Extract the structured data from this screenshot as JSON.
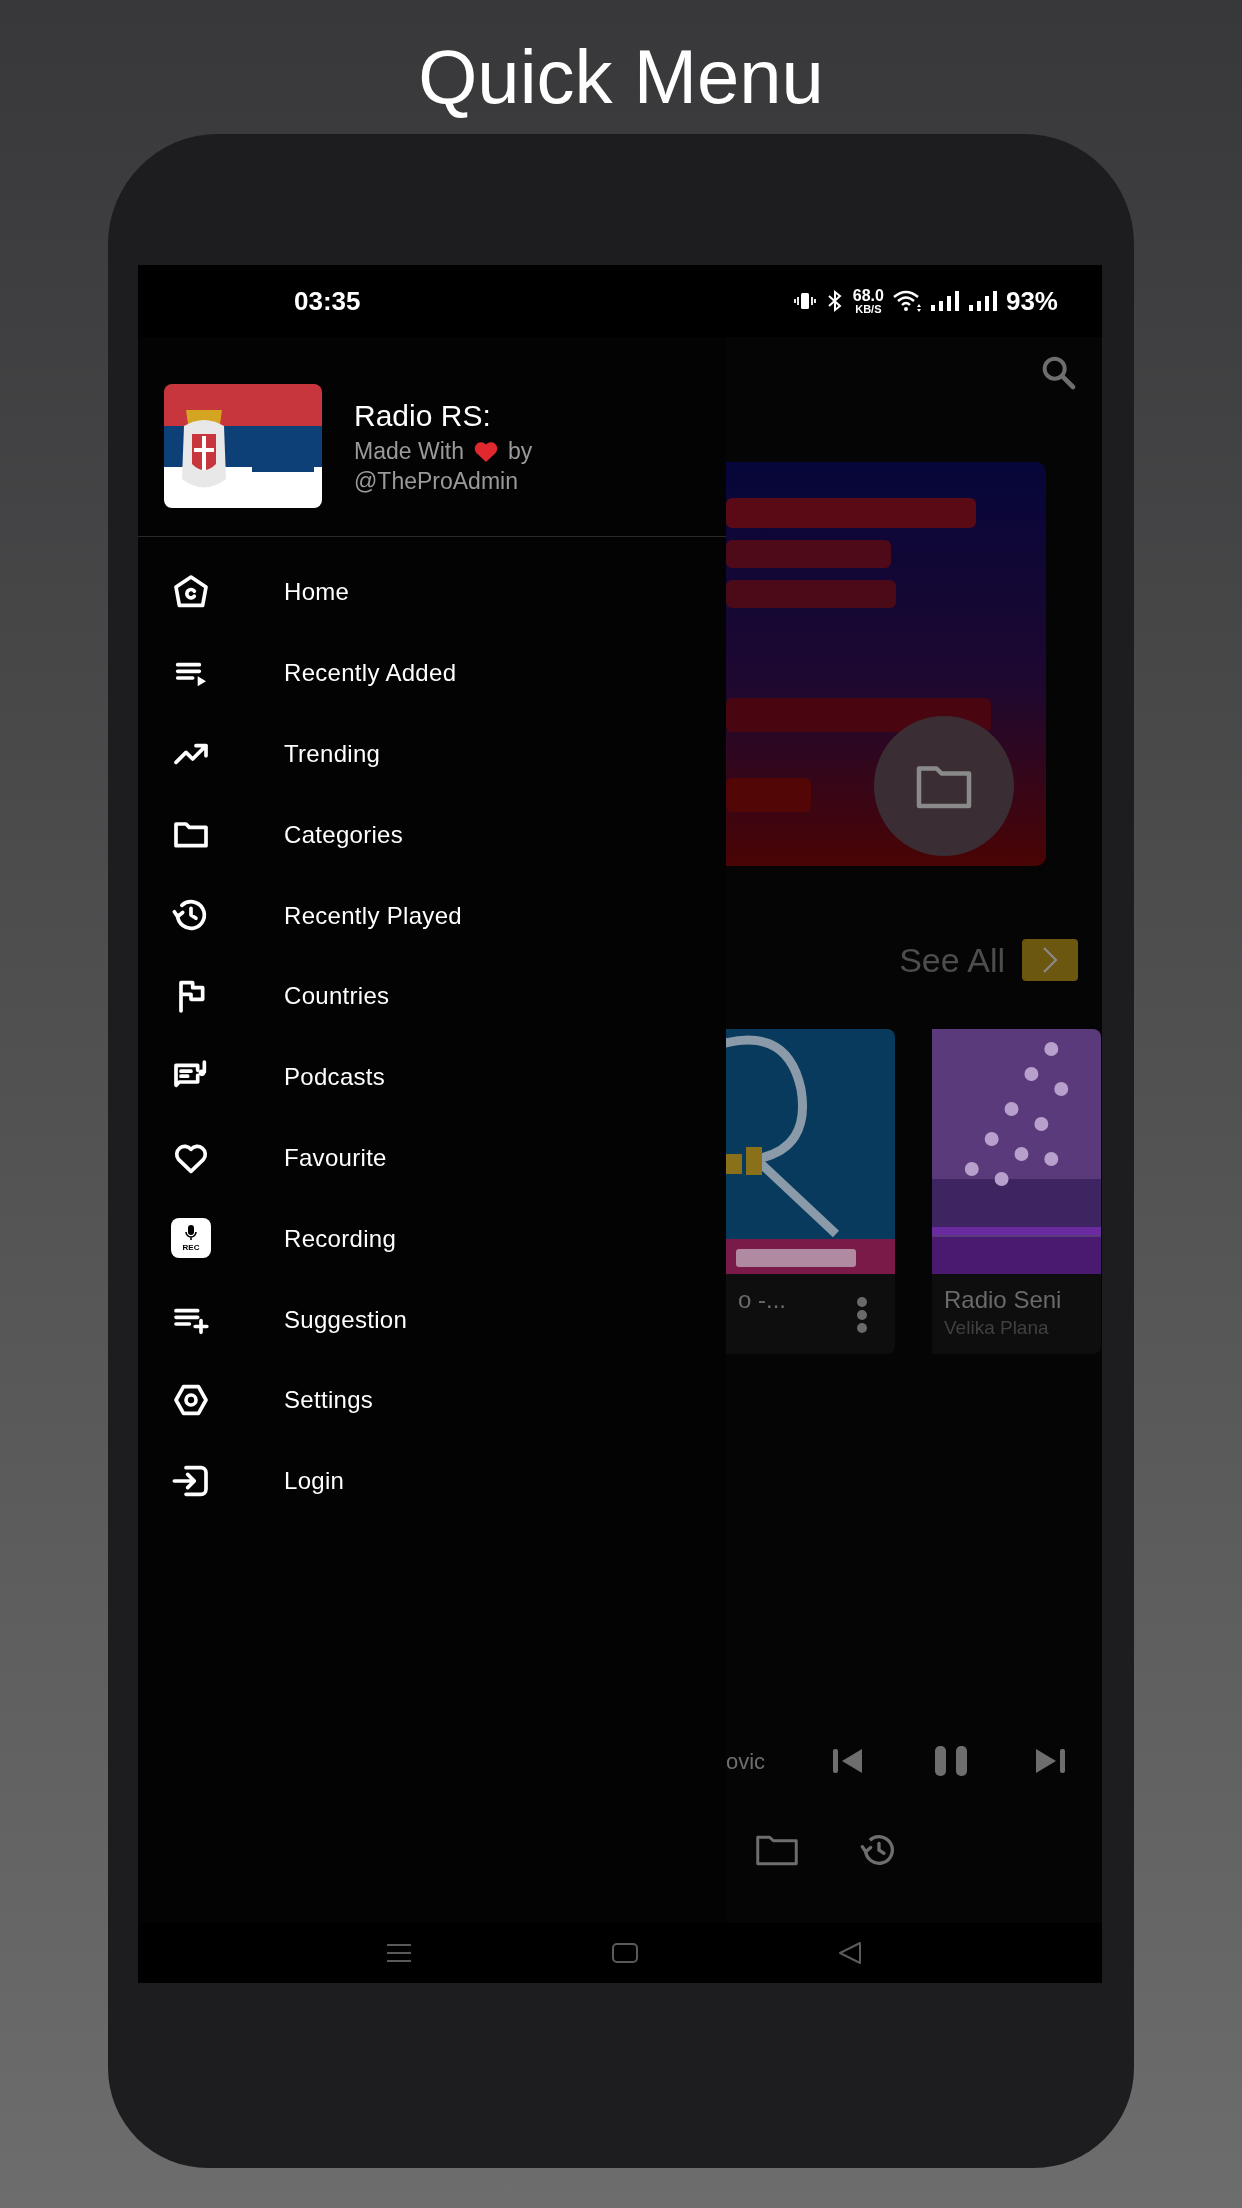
{
  "title": "Quick Menu",
  "status_bar": {
    "time": "03:35",
    "speed": "68.0",
    "speed_unit": "KB/S",
    "battery": "93%"
  },
  "drawer": {
    "app_name": "Radio RS:",
    "credit_before": "Made With",
    "credit_after": "by",
    "handle": "@TheProAdmin",
    "items": [
      {
        "label": "Home"
      },
      {
        "label": "Recently Added"
      },
      {
        "label": "Trending"
      },
      {
        "label": "Categories"
      },
      {
        "label": "Recently Played"
      },
      {
        "label": "Countries"
      },
      {
        "label": "Podcasts"
      },
      {
        "label": "Favourite"
      },
      {
        "label": "Recording",
        "badge": "REC"
      },
      {
        "label": "Suggestion"
      },
      {
        "label": "Settings"
      },
      {
        "label": "Login"
      }
    ]
  },
  "background": {
    "see_all": "See All",
    "cards": [
      {
        "title": "o -..."
      },
      {
        "title": "Radio Seni",
        "subtitle": "Velika Plana"
      }
    ],
    "now_playing": "ovic"
  }
}
